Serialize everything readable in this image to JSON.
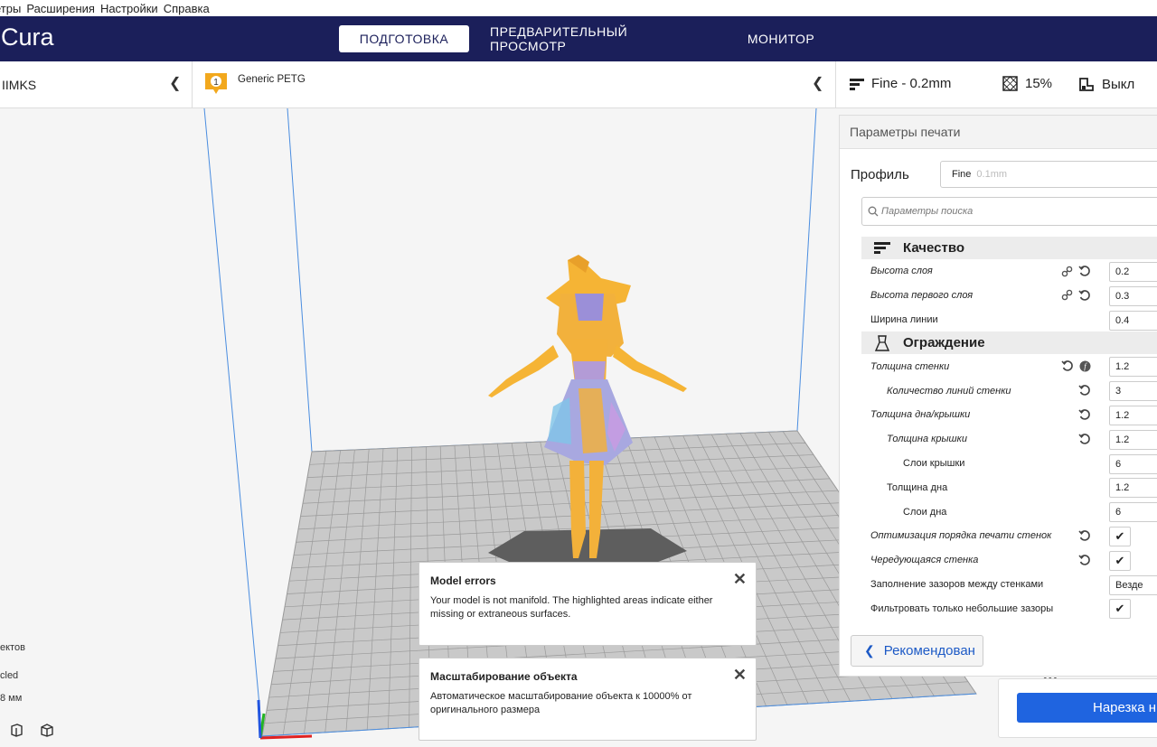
{
  "menu": [
    "етры",
    "Расширения",
    "Настройки",
    "Справка"
  ],
  "app": {
    "logo": "Cura"
  },
  "tabs": [
    {
      "label": "ПОДГОТОВКА",
      "active": true
    },
    {
      "label": "ПРЕДВАРИТЕЛЬНЫЙ ПРОСМОТР",
      "active": false
    },
    {
      "label": "МОНИТОР",
      "active": false
    }
  ],
  "printer": {
    "name": "IIMKS"
  },
  "material": {
    "badge": "1",
    "name": "Generic PETG",
    "color": "#f2a81d"
  },
  "quick": {
    "profile": "Fine - 0.2mm",
    "infill": "15%",
    "support": "Выкл"
  },
  "panel": {
    "title": "Параметры печати",
    "profile_label": "Профиль",
    "profile_value": "Fine",
    "profile_sub": "0.1mm",
    "search_placeholder": "Параметры поиска",
    "recommended_label": "Рекомендован",
    "categories": [
      {
        "name": "Качество",
        "icon": "quality-icon",
        "rows": [
          {
            "label": "Высота слоя",
            "italic": true,
            "indent": 0,
            "value": "0.2",
            "link": true,
            "reset": true
          },
          {
            "label": "Высота первого слоя",
            "italic": true,
            "indent": 0,
            "value": "0.3",
            "link": true,
            "reset": true
          },
          {
            "label": "Ширина линии",
            "italic": false,
            "indent": 0,
            "value": "0.4"
          }
        ]
      },
      {
        "name": "Ограждение",
        "icon": "shell-icon",
        "rows": [
          {
            "label": "Толщина стенки",
            "italic": true,
            "indent": 0,
            "value": "1.2",
            "reset": true,
            "function": true
          },
          {
            "label": "Количество линий стенки",
            "italic": true,
            "indent": 1,
            "value": "3",
            "reset": true
          },
          {
            "label": "Толщина дна/крышки",
            "italic": true,
            "indent": 0,
            "value": "1.2",
            "reset": true
          },
          {
            "label": "Толщина крышки",
            "italic": true,
            "indent": 1,
            "value": "1.2",
            "reset": true
          },
          {
            "label": "Слои крышки",
            "italic": false,
            "indent": 2,
            "value": "6"
          },
          {
            "label": "Толщина дна",
            "italic": false,
            "indent": 1,
            "value": "1.2"
          },
          {
            "label": "Слои дна",
            "italic": false,
            "indent": 2,
            "value": "6"
          },
          {
            "label": "Оптимизация порядка печати стенок",
            "italic": true,
            "indent": 0,
            "check": true,
            "reset": true
          },
          {
            "label": "Чередующаяся стенка",
            "italic": true,
            "indent": 0,
            "check": true,
            "reset": true
          },
          {
            "label": "Заполнение зазоров между стенками",
            "italic": false,
            "indent": 0,
            "value": "Везде"
          },
          {
            "label": "Фильтровать только небольшие зазоры",
            "italic": false,
            "indent": 0,
            "check": true
          }
        ]
      }
    ]
  },
  "slice": {
    "label": "Нарезка н"
  },
  "messages": [
    {
      "title": "Model errors",
      "body": "Your model is not manifold. The highlighted areas indicate either missing or extraneous surfaces."
    },
    {
      "title": "Масштабирование объекта",
      "body": "Автоматическое масштабирование объекта к 10000% от оригинального размера"
    }
  ],
  "object_info": {
    "line1": "ектов",
    "line2": "cled",
    "line3": "8 мм"
  }
}
